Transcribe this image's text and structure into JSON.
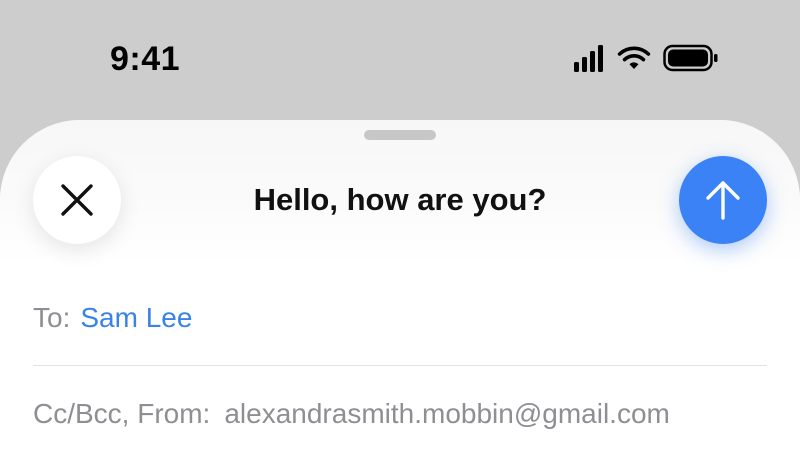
{
  "status": {
    "time": "9:41"
  },
  "compose": {
    "subject": "Hello, how are you?",
    "to_label": "To:",
    "to_value": "Sam Lee",
    "cc_label": "Cc/Bcc, From:",
    "cc_value": "alexandrasmith.mobbin@gmail.com"
  },
  "icons": {
    "close": "close-icon",
    "send": "arrow-up-icon",
    "signal": "cellular-signal-icon",
    "wifi": "wifi-icon",
    "battery": "battery-icon"
  },
  "colors": {
    "accent": "#3b82f6",
    "link": "#3b82e6",
    "secondary_text": "#8e8e93",
    "background": "#cdcdcd"
  }
}
